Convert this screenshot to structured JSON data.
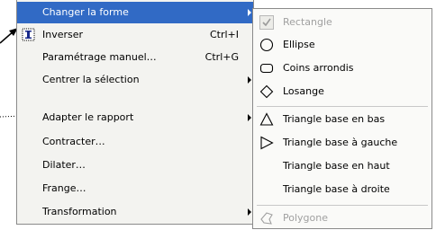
{
  "context_menu": {
    "items": [
      {
        "label": "Changer la forme",
        "shortcut": "",
        "submenu": true,
        "highlighted": true
      },
      {
        "label": "Inverser",
        "shortcut": "Ctrl+I",
        "submenu": false,
        "icon": "text-cursor-icon"
      },
      {
        "label": "Paramétrage manuel…",
        "shortcut": "Ctrl+G",
        "submenu": false
      },
      {
        "label": "Centrer la sélection",
        "shortcut": "",
        "submenu": true
      },
      {
        "label": "Adapter le rapport",
        "shortcut": "",
        "submenu": true
      },
      {
        "label": "Contracter…",
        "shortcut": "",
        "submenu": false
      },
      {
        "label": "Dilater…",
        "shortcut": "",
        "submenu": false
      },
      {
        "label": "Frange…",
        "shortcut": "",
        "submenu": false
      },
      {
        "label": "Transformation",
        "shortcut": "",
        "submenu": true
      }
    ],
    "highlight_color": "#316ac5"
  },
  "shape_submenu": {
    "items": [
      {
        "label": "Rectangle",
        "icon": "checkmark-icon",
        "enabled": false
      },
      {
        "label": "Ellipse",
        "icon": "ellipse-icon",
        "enabled": true
      },
      {
        "label": "Coins arrondis",
        "icon": "rounded-rectangle-icon",
        "enabled": true
      },
      {
        "label": "Losange",
        "icon": "diamond-icon",
        "enabled": true
      },
      {
        "label": "Triangle base en bas",
        "icon": "triangle-up-icon",
        "enabled": true
      },
      {
        "label": "Triangle base à gauche",
        "icon": "triangle-right-icon",
        "enabled": true
      },
      {
        "label": "Triangle base en haut",
        "icon": "",
        "enabled": true
      },
      {
        "label": "Triangle base à droite",
        "icon": "",
        "enabled": true
      },
      {
        "label": "Polygone",
        "icon": "polygon-icon",
        "enabled": false
      }
    ]
  }
}
